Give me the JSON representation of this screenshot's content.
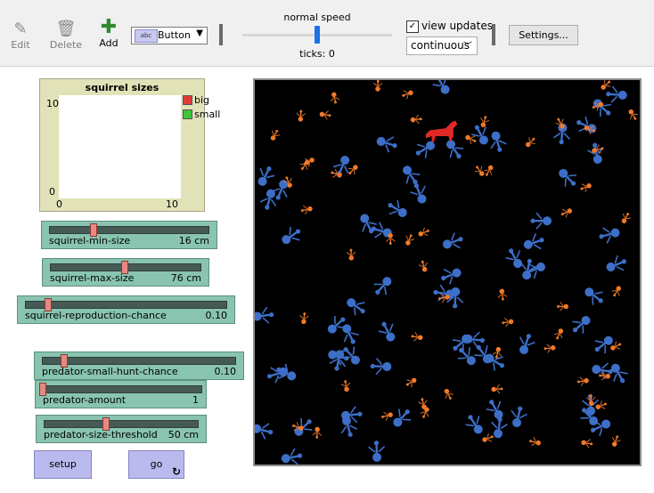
{
  "toolbar": {
    "edit_label": "Edit",
    "delete_label": "Delete",
    "add_label": "Add",
    "widget_chip": "abc",
    "widget_type": "Button",
    "speed_label": "normal speed",
    "speed_value": 0.5,
    "ticks_label": "ticks: 0",
    "view_updates_label": "view updates",
    "view_updates_checked": "✓",
    "update_mode": "continuous",
    "settings_label": "Settings..."
  },
  "plot": {
    "title": "squirrel sizes",
    "y_max": "10",
    "y_min": "0",
    "x_min": "0",
    "x_max": "10",
    "legend": [
      {
        "name": "big",
        "color": "#e03c3c"
      },
      {
        "name": "small",
        "color": "#3cc43c"
      }
    ]
  },
  "sliders": [
    {
      "name": "squirrel-min-size",
      "display": "16 cm",
      "fraction": 0.27
    },
    {
      "name": "squirrel-max-size",
      "display": "76 cm",
      "fraction": 0.5
    },
    {
      "name": "squirrel-reproduction-chance",
      "display": "0.10",
      "fraction": 0.1
    },
    {
      "name": "predator-small-hunt-chance",
      "display": "0.10",
      "fraction": 0.1
    },
    {
      "name": "predator-amount",
      "display": "1",
      "fraction": 0.0
    },
    {
      "name": "predator-size-threshold",
      "display": "50 cm",
      "fraction": 0.4
    }
  ],
  "buttons": {
    "setup_label": "setup",
    "go_label": "go",
    "go_forever_icon": "↻"
  },
  "world": {
    "background": "#000000",
    "big_color": "#3d6fc8",
    "small_color": "#f07a2a",
    "predator_color": "#e02828"
  }
}
